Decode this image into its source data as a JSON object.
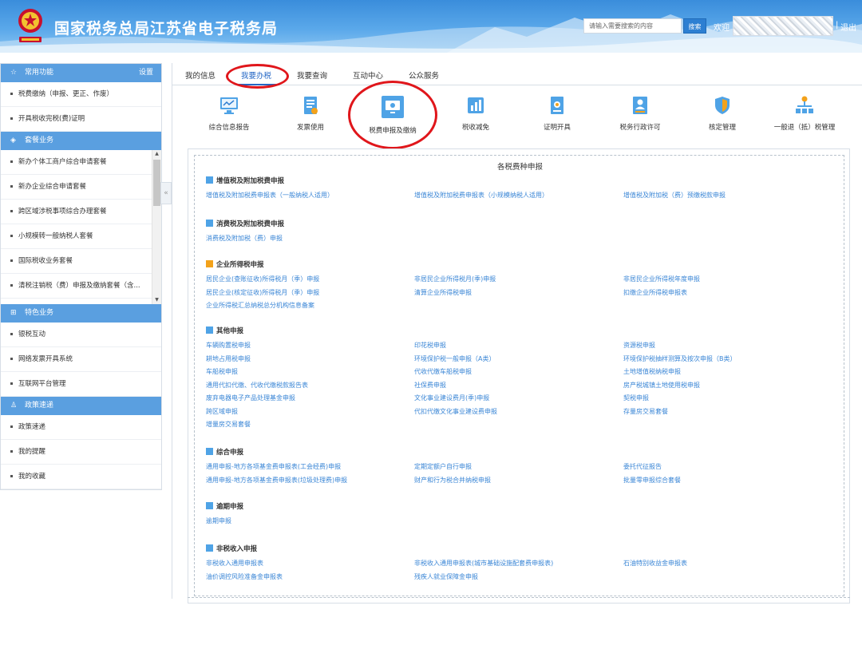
{
  "header": {
    "title": "国家税务总局江苏省电子税务局",
    "search_placeholder": "请输入需要搜索的内容",
    "search_button": "搜索",
    "welcome": "欢迎",
    "separator": "|",
    "logout": "退出",
    "brand_color": "#3a8ddb"
  },
  "sidebar": {
    "common": {
      "title": "常用功能",
      "settings": "设置",
      "items": [
        "税费缴纳（申报、更正、作废）",
        "开具税收完税(费)证明"
      ]
    },
    "package": {
      "title": "套餐业务",
      "items": [
        "新办个体工商户综合申请套餐",
        "新办企业综合申请套餐",
        "跨区域涉税事项综合办理套餐",
        "小规模转一般纳税人套餐",
        "国际税收业务套餐",
        "清税注销税（费）申报及缴纳套餐（含..."
      ]
    },
    "feature": {
      "title": "特色业务",
      "items": [
        "银税互动",
        "网络发票开具系统",
        "互联网平台管理"
      ]
    },
    "policy": {
      "title": "政策速递",
      "items": [
        "政策速递",
        "我的提醒",
        "我的收藏"
      ]
    },
    "collapse_glyph": "«"
  },
  "tabs": [
    "我的信息",
    "我要办税",
    "我要查询",
    "互动中心",
    "公众服务"
  ],
  "active_tab": "我要办税",
  "business": [
    {
      "label": "综合信息报告",
      "icon": "chart-monitor-icon"
    },
    {
      "label": "发票使用",
      "icon": "invoice-icon"
    },
    {
      "label": "税费申报及缴纳",
      "icon": "monitor-icon"
    },
    {
      "label": "税收减免",
      "icon": "bar-chart-icon"
    },
    {
      "label": "证明开具",
      "icon": "certificate-icon"
    },
    {
      "label": "税务行政许可",
      "icon": "id-card-icon"
    },
    {
      "label": "核定管理",
      "icon": "shield-icon"
    },
    {
      "label": "一般退（抵）税管理",
      "icon": "org-tree-icon"
    }
  ],
  "panel_title": "各税费种申报",
  "categories": [
    {
      "title": "增值税及附加税费申报",
      "links": [
        [
          "增值税及附加税费申报表（一般纳税人适用）",
          "增值税及附加税费申报表（小规模纳税人适用）",
          "增值税及附加税（费）预缴税款申报"
        ]
      ]
    },
    {
      "title": "消费税及附加税费申报",
      "links": [
        [
          "消费税及附加税（费）申报",
          "",
          ""
        ]
      ]
    },
    {
      "title": "企业所得税申报",
      "links": [
        [
          "居民企业(查账征收)所得税月（季）申报",
          "非居民企业所得税月(季)申报",
          "非居民企业所得税年度申报"
        ],
        [
          "居民企业(核定征收)所得税月（季）申报",
          "清算企业所得税申报",
          "扣缴企业所得税申报表"
        ],
        [
          "企业所得税汇总纳税总分机构信息备案",
          "",
          ""
        ]
      ]
    },
    {
      "title": "其他申报",
      "links": [
        [
          "车辆购置税申报",
          "印花税申报",
          "资源税申报"
        ],
        [
          "耕地占用税申报",
          "环境保护税一般申报（A类）",
          "环境保护税抽样测算及按次申报（B类）"
        ],
        [
          "车船税申报",
          "代收代缴车船税申报",
          "土地增值税纳税申报"
        ],
        [
          "通用代扣代缴、代收代缴税款报告表",
          "社保费申报",
          "房产税城镇土地使用税申报"
        ],
        [
          "废弃电器电子产品处理基金申报",
          "文化事业建设费月(季)申报",
          "契税申报"
        ],
        [
          "跨区域申报",
          "代扣代缴文化事业建设费申报",
          "存量房交易套餐"
        ],
        [
          "增量房交易套餐",
          "",
          ""
        ]
      ]
    },
    {
      "title": "综合申报",
      "links": [
        [
          "通用申报-地方各项基金费申报表(工会经费)申报",
          "定期定额户自行申报",
          "委托代征报告"
        ],
        [
          "通用申报-地方各项基金费申报表(垃圾处理费)申报",
          "财产和行为税合并纳税申报",
          "批量零申报综合套餐"
        ]
      ]
    },
    {
      "title": "逾期申报",
      "links": [
        [
          "逾期申报",
          "",
          ""
        ]
      ]
    },
    {
      "title": "非税收入申报",
      "links": [
        [
          "非税收入通用申报表",
          "非税收入通用申报表(城市基础设施配套费申报表)",
          "石油特别收益金申报表"
        ],
        [
          "油价调控风险准备金申报表",
          "残疾人就业保障金申报",
          ""
        ]
      ]
    }
  ]
}
